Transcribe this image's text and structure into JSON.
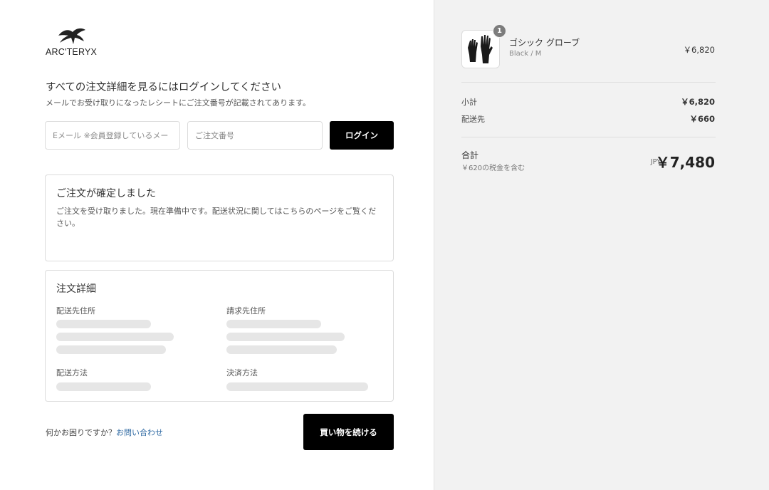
{
  "brand": {
    "name": "ARC'TERYX"
  },
  "login": {
    "heading": "すべての注文詳細を見るにはログインしてください",
    "subheading": "メールでお受け取りになったレシートにご注文番号が記載されてあります。",
    "email_placeholder": "Eメール ※会員登録しているメー",
    "order_placeholder": "ご注文番号",
    "login_button": "ログイン"
  },
  "confirmation": {
    "title": "ご注文が確定しました",
    "text": "ご注文を受け取りました。現在準備中です。配送状況に関してはこちらのページをご覧ください。"
  },
  "order_details": {
    "title": "注文詳細",
    "shipping_address_label": "配送先住所",
    "billing_address_label": "請求先住所",
    "shipping_method_label": "配送方法",
    "payment_method_label": "決済方法"
  },
  "footer": {
    "help_text": "何かお困りですか？",
    "contact_link": "お問い合わせ",
    "continue_button": "買い物を続ける"
  },
  "cart": {
    "item": {
      "quantity": "1",
      "name": "ゴシック グローブ",
      "variant": "Black / M",
      "price": "￥6,820",
      "thumbnail_icon": "gloves-icon"
    },
    "subtotal_label": "小計",
    "subtotal_value": "￥6,820",
    "shipping_label": "配送先",
    "shipping_value": "￥660",
    "total_label": "合計",
    "tax_note": "￥620の税金を含む",
    "currency": "JPY",
    "total_value": "￥7,480"
  },
  "colors": {
    "button_bg": "#000000",
    "link": "#2f6aa3",
    "sidebar_bg": "#f2f2f2",
    "skeleton": "#e6e6e6"
  }
}
